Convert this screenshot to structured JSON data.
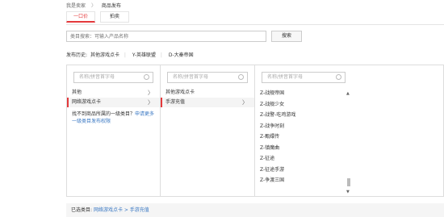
{
  "breadcrumb": {
    "home": "我是卖家",
    "separator": "〉",
    "current": "商品发布"
  },
  "tabs": [
    {
      "label": "一口价"
    },
    {
      "label": "拍卖"
    }
  ],
  "search": {
    "placeholder": "类目搜索：可输入产品名称",
    "button": "搜索"
  },
  "history": {
    "label": "发布历史:",
    "items": [
      "其他游戏点卡",
      "Y-英雄联盟",
      "D-大秦帝国"
    ]
  },
  "column1": {
    "search_placeholder": "名称/拼音首字母",
    "items": [
      {
        "label": "其他",
        "arrow": "〉"
      },
      {
        "label": "网络游戏点卡",
        "arrow": "〉"
      }
    ],
    "note_text": "找不到商品所属的一级类目？",
    "note_link": "申请更多一级类目发布权限"
  },
  "column2": {
    "search_placeholder": "名称/拼音首字母",
    "items": [
      {
        "label": "其他游戏点卡"
      },
      {
        "label": "手游充值",
        "arrow": "〉"
      }
    ]
  },
  "column3": {
    "search_placeholder": "名称/拼音首字母",
    "items": [
      "Z-战舰帝国",
      "Z-战舰少女",
      "Z-战警-吃鸡游戏",
      "Z-战争时刻",
      "Z-甄嬛传",
      "Z-镇魔曲",
      "Z-征途",
      "Z-征途手游",
      "Z-争渡三国"
    ]
  },
  "selected": {
    "label": "已选类目:",
    "path": "网络游戏点卡 > 手游充值"
  },
  "colors": {
    "accent": "#e4393c",
    "link": "#3a78c3"
  }
}
